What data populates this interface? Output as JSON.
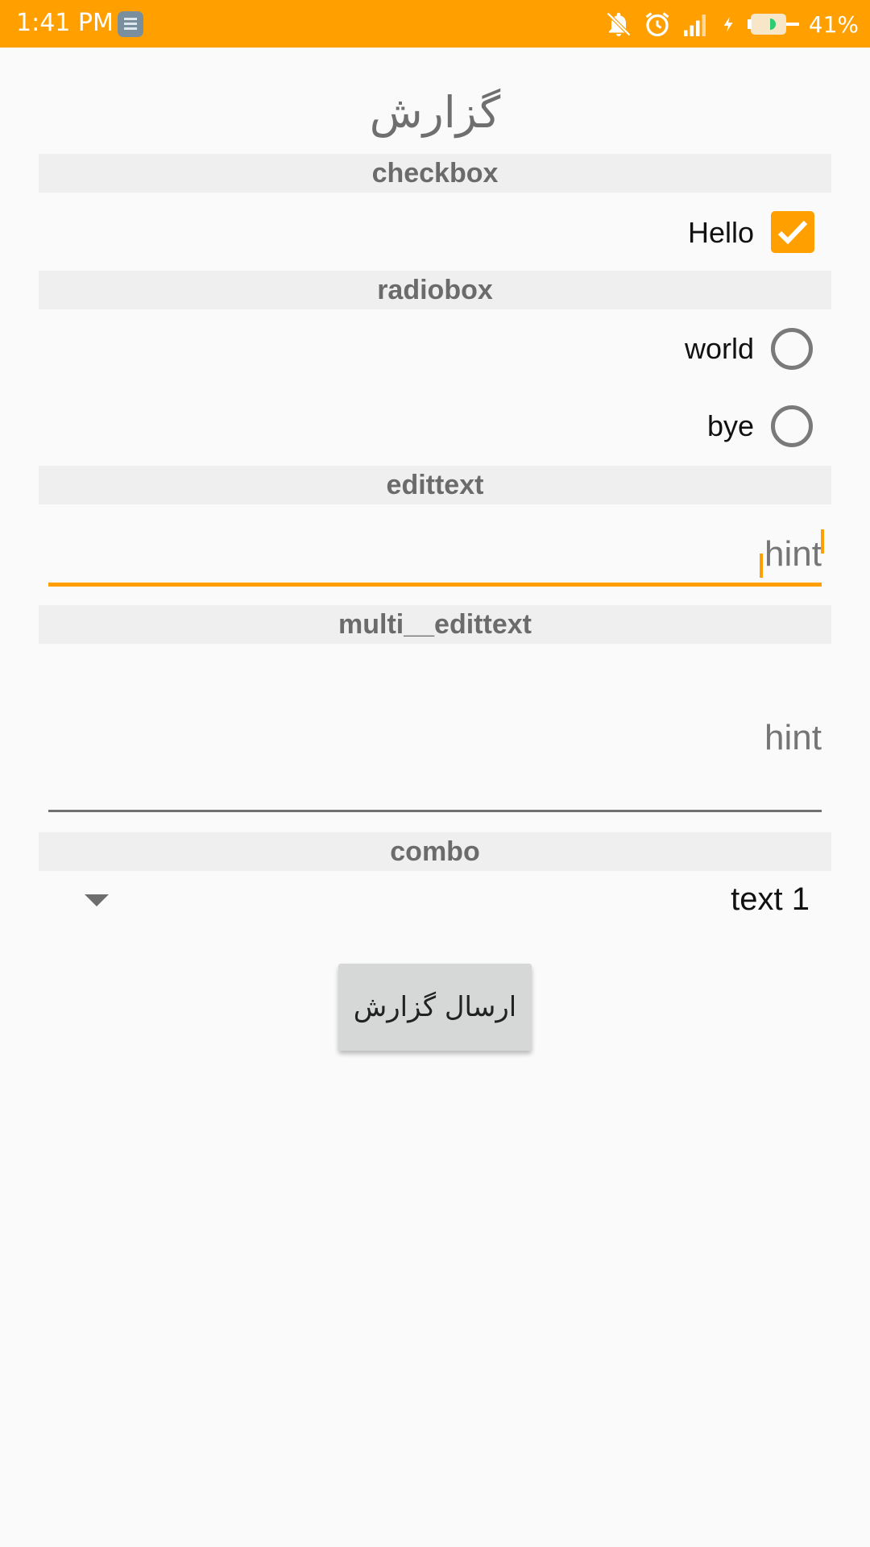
{
  "status_bar": {
    "time": "1:41 PM",
    "battery_percent": "41%",
    "icons": [
      "app-notification-icon",
      "mute-icon",
      "alarm-icon",
      "signal-icon",
      "charging-icon",
      "battery-icon"
    ]
  },
  "page": {
    "title": "گزارش"
  },
  "sections": {
    "checkbox": "checkbox",
    "radiobox": "radiobox",
    "edittext": "edittext",
    "multi_edittext": "multi__edittext",
    "combo": "combo"
  },
  "checkbox_item": {
    "label": "Hello",
    "checked": true
  },
  "radio_items": [
    {
      "label": "world",
      "selected": false
    },
    {
      "label": "bye",
      "selected": false
    }
  ],
  "edittext": {
    "placeholder": "hint",
    "value": ""
  },
  "multi_edittext": {
    "placeholder": "hint",
    "value": ""
  },
  "combo": {
    "selected": "text 1"
  },
  "submit_button": {
    "label": "ارسال گزارش"
  },
  "colors": {
    "accent": "#ff9f00",
    "section_bg": "#efefef",
    "background": "#fafafa"
  }
}
